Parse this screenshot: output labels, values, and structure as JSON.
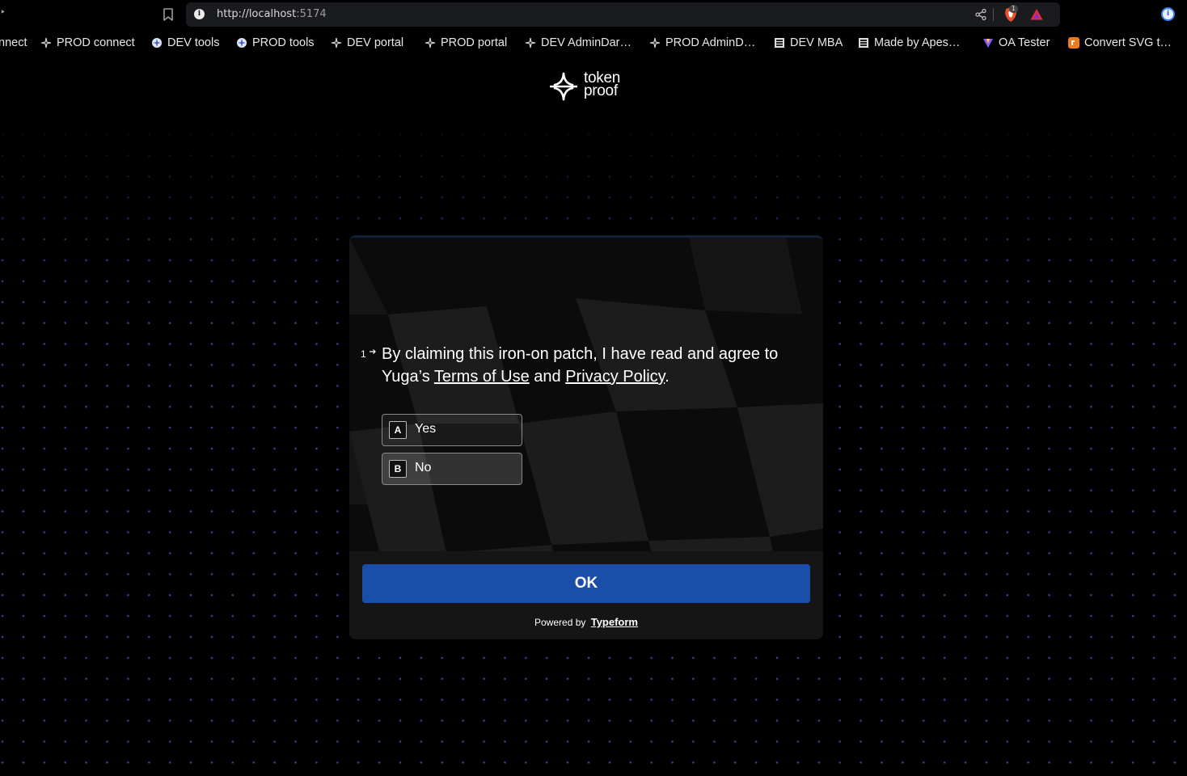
{
  "browser": {
    "url_scheme_host": "http://localhost",
    "url_port": ":5174",
    "rewards_badge": "1",
    "bookmarks": [
      {
        "label": "nnect",
        "icon": "sparkle-icon"
      },
      {
        "label": "PROD connect",
        "icon": "sparkle-icon"
      },
      {
        "label": "DEV tools",
        "icon": "globe-icon"
      },
      {
        "label": "PROD tools",
        "icon": "globe-icon"
      },
      {
        "label": "DEV portal",
        "icon": "sparkle-icon"
      },
      {
        "label": "PROD portal",
        "icon": "sparkle-icon"
      },
      {
        "label": "DEV AdminDar…",
        "icon": "sparkle-icon"
      },
      {
        "label": "PROD AdminD…",
        "icon": "sparkle-icon"
      },
      {
        "label": "DEV MBA",
        "icon": "made-badge-icon"
      },
      {
        "label": "Made by Apes…",
        "icon": "made-badge-icon"
      },
      {
        "label": "OA Tester",
        "icon": "vite-icon"
      },
      {
        "label": "Convert SVG t…",
        "icon": "converter-icon"
      }
    ]
  },
  "logo": {
    "line1": "token",
    "line2": "proof"
  },
  "form": {
    "question_number": "1",
    "question_prefix": "By claiming this iron-on patch, I have read and agree to Yuga’s ",
    "terms_link": "Terms of Use",
    "conjunction": " and ",
    "privacy_link": "Privacy Policy",
    "question_suffix": ".",
    "choices": [
      {
        "key": "A",
        "label": "Yes"
      },
      {
        "key": "B",
        "label": "No"
      }
    ],
    "submit_label": "OK",
    "powered_prefix": "Powered by",
    "powered_brand": "Typeform"
  },
  "colors": {
    "accent": "#1a4ea8",
    "dot_grid": "#374baa",
    "card": "#151515"
  }
}
